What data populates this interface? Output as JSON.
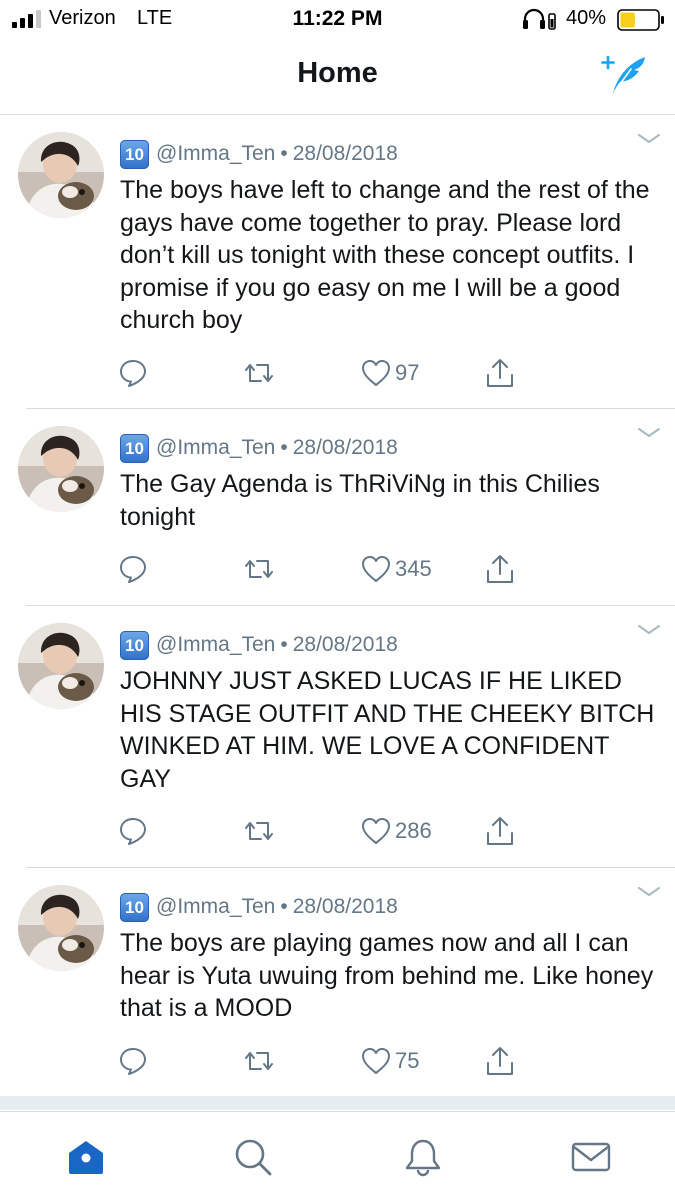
{
  "status_bar": {
    "carrier": "Verizon",
    "network": "LTE",
    "time": "11:22 PM",
    "battery_percent": "40%",
    "battery_level": 0.4,
    "battery_color": "#f7cf1d"
  },
  "header": {
    "title": "Home",
    "compose_icon": "compose-tweet-icon"
  },
  "colors": {
    "accent": "#1da1f2",
    "text": "#14171a",
    "secondary_text": "#657786",
    "divider": "#d7dbde"
  },
  "tweets": [
    {
      "badge": "10",
      "handle": "@Imma_Ten",
      "separator": "•",
      "date": "28/08/2018",
      "text": "The boys have left to change and the rest of the gays have come together to pray. Please lord don’t kill us tonight with these concept outfits. I promise if you go easy on me I will be a good church boy",
      "likes": "97"
    },
    {
      "badge": "10",
      "handle": "@Imma_Ten",
      "separator": "•",
      "date": "28/08/2018",
      "text": "The Gay Agenda is ThRiViNg in this Chilies tonight",
      "likes": "345"
    },
    {
      "badge": "10",
      "handle": "@Imma_Ten",
      "separator": "•",
      "date": "28/08/2018",
      "text": "JOHNNY JUST ASKED LUCAS IF HE LIKED HIS STAGE OUTFIT AND THE CHEEKY BITCH WINKED AT HIM. WE LOVE A CONFIDENT GAY",
      "likes": "286"
    },
    {
      "badge": "10",
      "handle": "@Imma_Ten",
      "separator": "•",
      "date": "28/08/2018",
      "text": "The boys are playing games now and all I can hear is Yuta uwuing from behind me. Like honey that is a MOOD",
      "likes": "75"
    }
  ],
  "tabs": [
    {
      "name": "home",
      "icon": "home-icon",
      "active": true
    },
    {
      "name": "search",
      "icon": "search-icon",
      "active": false
    },
    {
      "name": "notifications",
      "icon": "bell-icon",
      "active": false
    },
    {
      "name": "messages",
      "icon": "envelope-icon",
      "active": false
    }
  ]
}
